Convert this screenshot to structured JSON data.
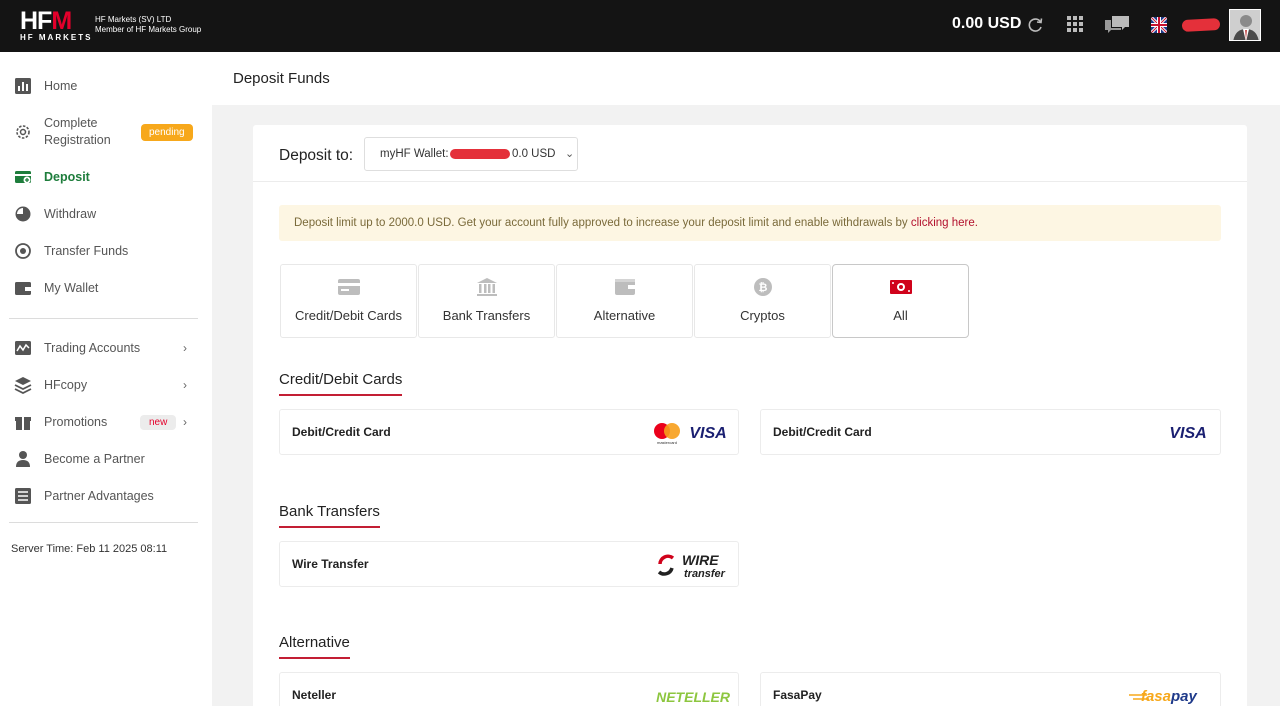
{
  "topbar": {
    "logo_text_a": "HF",
    "logo_text_b": "M",
    "logo_sub": "HF MARKETS",
    "company_line1": "HF Markets (SV) LTD",
    "company_line2": "Member of HF Markets Group",
    "balance": "0.00 USD"
  },
  "sidebar": {
    "items": [
      {
        "label": "Home",
        "icon": "chart-icon"
      },
      {
        "label": "Complete Registration",
        "icon": "gear-icon",
        "badge": "pending"
      },
      {
        "label": "Deposit",
        "icon": "deposit-icon"
      },
      {
        "label": "Withdraw",
        "icon": "withdraw-icon"
      },
      {
        "label": "Transfer Funds",
        "icon": "transfer-icon"
      },
      {
        "label": "My Wallet",
        "icon": "wallet-icon"
      },
      {
        "label": "Trading Accounts",
        "icon": "trading-icon"
      },
      {
        "label": "HFcopy",
        "icon": "layers-icon"
      },
      {
        "label": "Promotions",
        "icon": "gift-icon",
        "badge": "new"
      },
      {
        "label": "Become a Partner",
        "icon": "person-icon"
      },
      {
        "label": "Partner Advantages",
        "icon": "list-icon"
      }
    ],
    "server_time": "Server Time: Feb 11 2025 08:11"
  },
  "page": {
    "title": "Deposit Funds"
  },
  "deposit": {
    "label": "Deposit to:",
    "wallet_prefix": "myHF Wallet:",
    "wallet_amount": "0.0 USD"
  },
  "notice": {
    "text": "Deposit limit up to 2000.0 USD. Get your account fully approved to increase your deposit limit and enable withdrawals by ",
    "link": "clicking here."
  },
  "tabs": [
    {
      "label": "Credit/Debit Cards"
    },
    {
      "label": "Bank Transfers"
    },
    {
      "label": "Alternative"
    },
    {
      "label": "Cryptos"
    },
    {
      "label": "All"
    }
  ],
  "sections": {
    "cards_title": "Credit/Debit Cards",
    "bank_title": "Bank Transfers",
    "alt_title": "Alternative"
  },
  "methods": {
    "card1": "Debit/Credit Card",
    "card2": "Debit/Credit Card",
    "wire": "Wire Transfer",
    "neteller": "Neteller",
    "fasapay": "FasaPay"
  },
  "logos": {
    "visa": "VISA",
    "mastercard": "mastercard",
    "wire_a": "WIRE",
    "wire_b": "transfer",
    "neteller": "NETELLER",
    "fasa_a": "fasa",
    "fasa_b": "pay"
  },
  "colors": {
    "brand_red": "#e4002b",
    "active_green": "#1e7d3c",
    "pending": "#f7a81b"
  }
}
